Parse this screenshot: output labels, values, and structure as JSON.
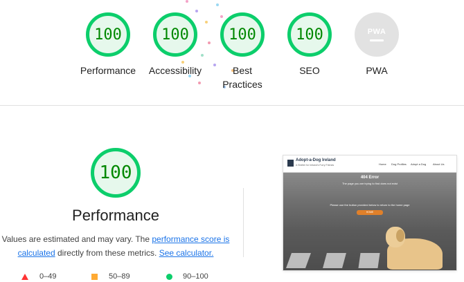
{
  "categories": [
    {
      "score": "100",
      "label": "Performance"
    },
    {
      "score": "100",
      "label": "Accessibility"
    },
    {
      "score": "100",
      "label": "Best Practices"
    },
    {
      "score": "100",
      "label": "SEO"
    },
    {
      "score": "",
      "label": "PWA",
      "badge_text": "PWA"
    }
  ],
  "performance": {
    "score": "100",
    "title": "Performance",
    "desc_part1": "Values are estimated and may vary. The ",
    "link_score": "performance score is calculated",
    "desc_part2": " directly from these metrics. ",
    "link_calc": "See calculator."
  },
  "legend": [
    {
      "range": "0–49",
      "color": "#ff3333"
    },
    {
      "range": "50–89",
      "color": "#ffaa33"
    },
    {
      "range": "90–100",
      "color": "#0cce6b"
    }
  ],
  "screenshot": {
    "brand": "Adopt-a-Dog Ireland",
    "tagline": "A Shelter for Ireland's Furry Friends",
    "nav": [
      "Home",
      "Dog Profiles",
      "Adopt a Dog",
      "About Us"
    ],
    "error_title": "404 Error",
    "line1": "The page you are trying to find does not exist",
    "line2": "Please use the button provided below to return to the home page",
    "button": "HOME"
  },
  "colors": {
    "pass": "#0cce6b",
    "pass_text": "#008800",
    "average": "#ffaa33",
    "fail": "#ff3333",
    "link": "#1a73e8"
  }
}
